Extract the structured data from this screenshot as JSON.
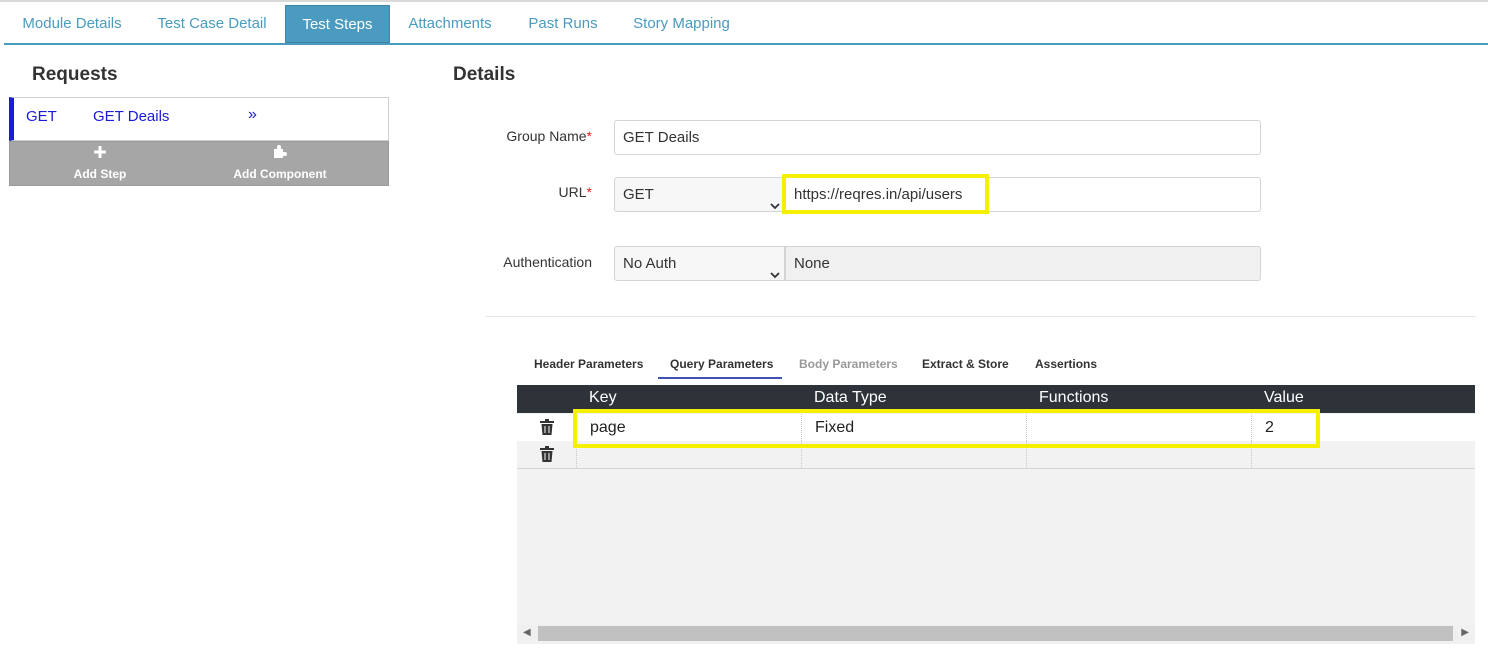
{
  "tabs": [
    {
      "label": "Module Details"
    },
    {
      "label": "Test Case Detail"
    },
    {
      "label": "Test Steps",
      "active": true
    },
    {
      "label": "Attachments"
    },
    {
      "label": "Past Runs"
    },
    {
      "label": "Story Mapping"
    }
  ],
  "requests": {
    "title": "Requests",
    "items": [
      {
        "method": "GET",
        "name": "GET Deails",
        "arrow": "»"
      }
    ],
    "add_step": "Add Step",
    "add_component": "Add Component"
  },
  "details": {
    "title": "Details",
    "group_name_label": "Group Name",
    "group_name_value": "GET Deails",
    "url_label": "URL",
    "url_method": "GET",
    "url_value": "https://reqres.in/api/users",
    "auth_label": "Authentication",
    "auth_type": "No Auth",
    "auth_value": "None",
    "required_mark": "*"
  },
  "subtabs": [
    {
      "label": "Header Parameters"
    },
    {
      "label": "Query Parameters",
      "active": true
    },
    {
      "label": "Body Parameters",
      "disabled": true
    },
    {
      "label": "Extract & Store"
    },
    {
      "label": "Assertions"
    }
  ],
  "grid": {
    "columns": [
      "Key",
      "Data Type",
      "Functions",
      "Value"
    ],
    "rows": [
      {
        "key": "page",
        "data_type": "Fixed",
        "functions": "",
        "value": "2"
      },
      {
        "key": "",
        "data_type": "",
        "functions": "",
        "value": ""
      }
    ],
    "scroll_left": "◀",
    "scroll_right": "▶"
  },
  "colors": {
    "accent": "#4a9bbf",
    "request_blue": "#1a1adb",
    "highlight": "#f5f000",
    "grid_header": "#2d3339"
  }
}
